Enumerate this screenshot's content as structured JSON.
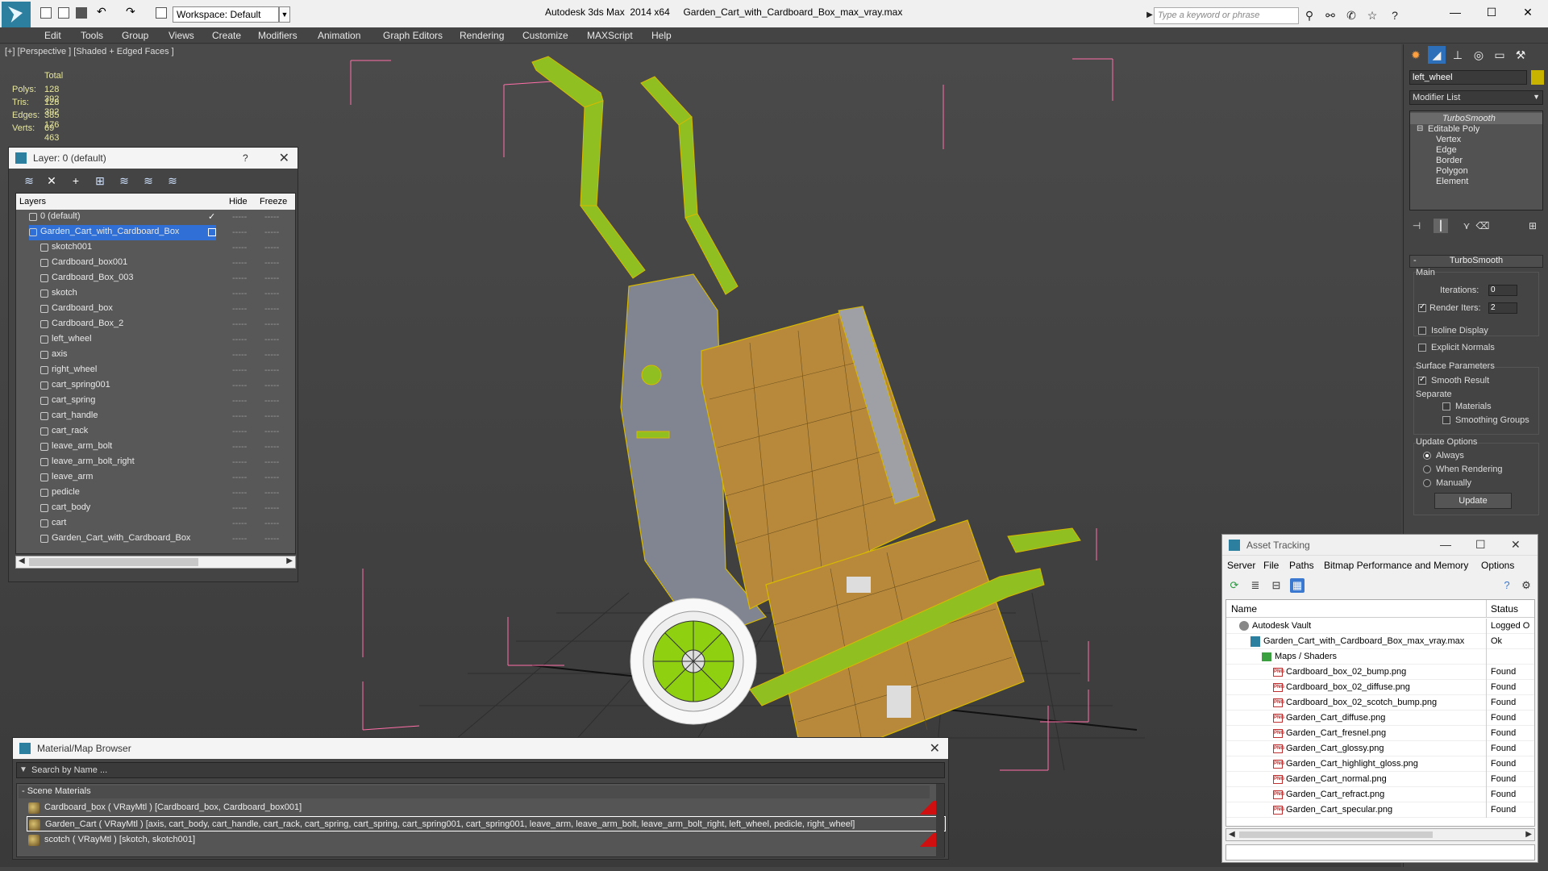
{
  "titlebar": {
    "workspace": "Workspace: Default",
    "app_title": "Autodesk 3ds Max  2014 x64",
    "file_title": "Garden_Cart_with_Cardboard_Box_max_vray.max",
    "search_placeholder": "Type a keyword or phrase",
    "minimize": "—",
    "maximize": "☐",
    "close": "✕"
  },
  "menu": [
    "Edit",
    "Tools",
    "Group",
    "Views",
    "Create",
    "Modifiers",
    "Animation",
    "Graph Editors",
    "Rendering",
    "Customize",
    "MAXScript",
    "Help"
  ],
  "viewport": {
    "label": "[+] [Perspective ] [Shaded + Edged Faces ]",
    "stats_header": "Total",
    "stats": [
      {
        "label": "Polys:",
        "value": "128 392"
      },
      {
        "label": "Tris:",
        "value": "128 392"
      },
      {
        "label": "Edges:",
        "value": "385 176"
      },
      {
        "label": "Verts:",
        "value": "69 463"
      }
    ]
  },
  "layer_panel": {
    "title": "Layer: 0 (default)",
    "help": "?",
    "close": "✕",
    "col_layers": "Layers",
    "col_hide": "Hide",
    "col_freeze": "Freeze",
    "dots": "-----",
    "rows": [
      {
        "name": "0 (default)",
        "level": 0,
        "check": "✓"
      },
      {
        "name": "Garden_Cart_with_Cardboard_Box",
        "level": 0,
        "selected": true
      },
      {
        "name": "skotch001",
        "level": 1
      },
      {
        "name": "Cardboard_box001",
        "level": 1
      },
      {
        "name": "Cardboard_Box_003",
        "level": 1
      },
      {
        "name": "skotch",
        "level": 1
      },
      {
        "name": "Cardboard_box",
        "level": 1
      },
      {
        "name": "Cardboard_Box_2",
        "level": 1
      },
      {
        "name": "left_wheel",
        "level": 1
      },
      {
        "name": "axis",
        "level": 1
      },
      {
        "name": "right_wheel",
        "level": 1
      },
      {
        "name": "cart_spring001",
        "level": 1
      },
      {
        "name": "cart_spring",
        "level": 1
      },
      {
        "name": "cart_handle",
        "level": 1
      },
      {
        "name": "cart_rack",
        "level": 1
      },
      {
        "name": "leave_arm_bolt",
        "level": 1
      },
      {
        "name": "leave_arm_bolt_right",
        "level": 1
      },
      {
        "name": "leave_arm",
        "level": 1
      },
      {
        "name": "pedicle",
        "level": 1
      },
      {
        "name": "cart_body",
        "level": 1
      },
      {
        "name": "cart",
        "level": 1
      },
      {
        "name": "Garden_Cart_with_Cardboard_Box",
        "level": 1
      }
    ]
  },
  "command_panel": {
    "object_name": "left_wheel",
    "modifier_list": "Modifier List",
    "stack": [
      {
        "name": "TurboSmooth",
        "italic": true
      },
      {
        "name": "Editable Poly"
      },
      {
        "name": "Vertex"
      },
      {
        "name": "Edge"
      },
      {
        "name": "Border"
      },
      {
        "name": "Polygon"
      },
      {
        "name": "Element"
      }
    ],
    "rollout_title": "TurboSmooth",
    "main_label": "Main",
    "iterations_label": "Iterations:",
    "iterations_value": "0",
    "render_iters_label": "Render Iters:",
    "render_iters_value": "2",
    "isoline": "Isoline Display",
    "explicit_normals": "Explicit Normals",
    "surface_params": "Surface Parameters",
    "smooth_result": "Smooth Result",
    "separate": "Separate",
    "materials": "Materials",
    "smoothing_groups": "Smoothing Groups",
    "update_options": "Update Options",
    "always": "Always",
    "when_rendering": "When Rendering",
    "manually": "Manually",
    "update_btn": "Update"
  },
  "material_browser": {
    "title": "Material/Map Browser",
    "close": "✕",
    "search_placeholder": "Search by Name ...",
    "group": "- Scene Materials",
    "rows": [
      "Cardboard_box  ( VRayMtl )  [Cardboard_box, Cardboard_box001]",
      "Garden_Cart  ( VRayMtl )  [axis, cart_body, cart_handle, cart_rack, cart_spring, cart_spring, cart_spring001, cart_spring001, leave_arm, leave_arm_bolt, leave_arm_bolt_right, left_wheel, pedicle, right_wheel]",
      "scotch  ( VRayMtl )  [skotch, skotch001]"
    ]
  },
  "asset_tracking": {
    "title": "Asset Tracking",
    "menu": [
      "Server",
      "File",
      "Paths",
      "Bitmap Performance and Memory",
      "Options"
    ],
    "col_name": "Name",
    "col_status": "Status",
    "rows": [
      {
        "name": "Autodesk Vault",
        "status": "Logged O",
        "level": 0,
        "icon": "vault"
      },
      {
        "name": "Garden_Cart_with_Cardboard_Box_max_vray.max",
        "status": "Ok",
        "level": 1,
        "icon": "max"
      },
      {
        "name": "Maps / Shaders",
        "status": "",
        "level": 2,
        "icon": "maps"
      },
      {
        "name": "Cardboard_box_02_bump.png",
        "status": "Found",
        "level": 3,
        "icon": "png"
      },
      {
        "name": "Cardboard_box_02_diffuse.png",
        "status": "Found",
        "level": 3,
        "icon": "png"
      },
      {
        "name": "Cardboard_box_02_scotch_bump.png",
        "status": "Found",
        "level": 3,
        "icon": "png"
      },
      {
        "name": "Garden_Cart_diffuse.png",
        "status": "Found",
        "level": 3,
        "icon": "png"
      },
      {
        "name": "Garden_Cart_fresnel.png",
        "status": "Found",
        "level": 3,
        "icon": "png"
      },
      {
        "name": "Garden_Cart_glossy.png",
        "status": "Found",
        "level": 3,
        "icon": "png"
      },
      {
        "name": "Garden_Cart_highlight_gloss.png",
        "status": "Found",
        "level": 3,
        "icon": "png"
      },
      {
        "name": "Garden_Cart_normal.png",
        "status": "Found",
        "level": 3,
        "icon": "png"
      },
      {
        "name": "Garden_Cart_refract.png",
        "status": "Found",
        "level": 3,
        "icon": "png"
      },
      {
        "name": "Garden_Cart_specular.png",
        "status": "Found",
        "level": 3,
        "icon": "png"
      }
    ]
  },
  "png_label": "PNG"
}
